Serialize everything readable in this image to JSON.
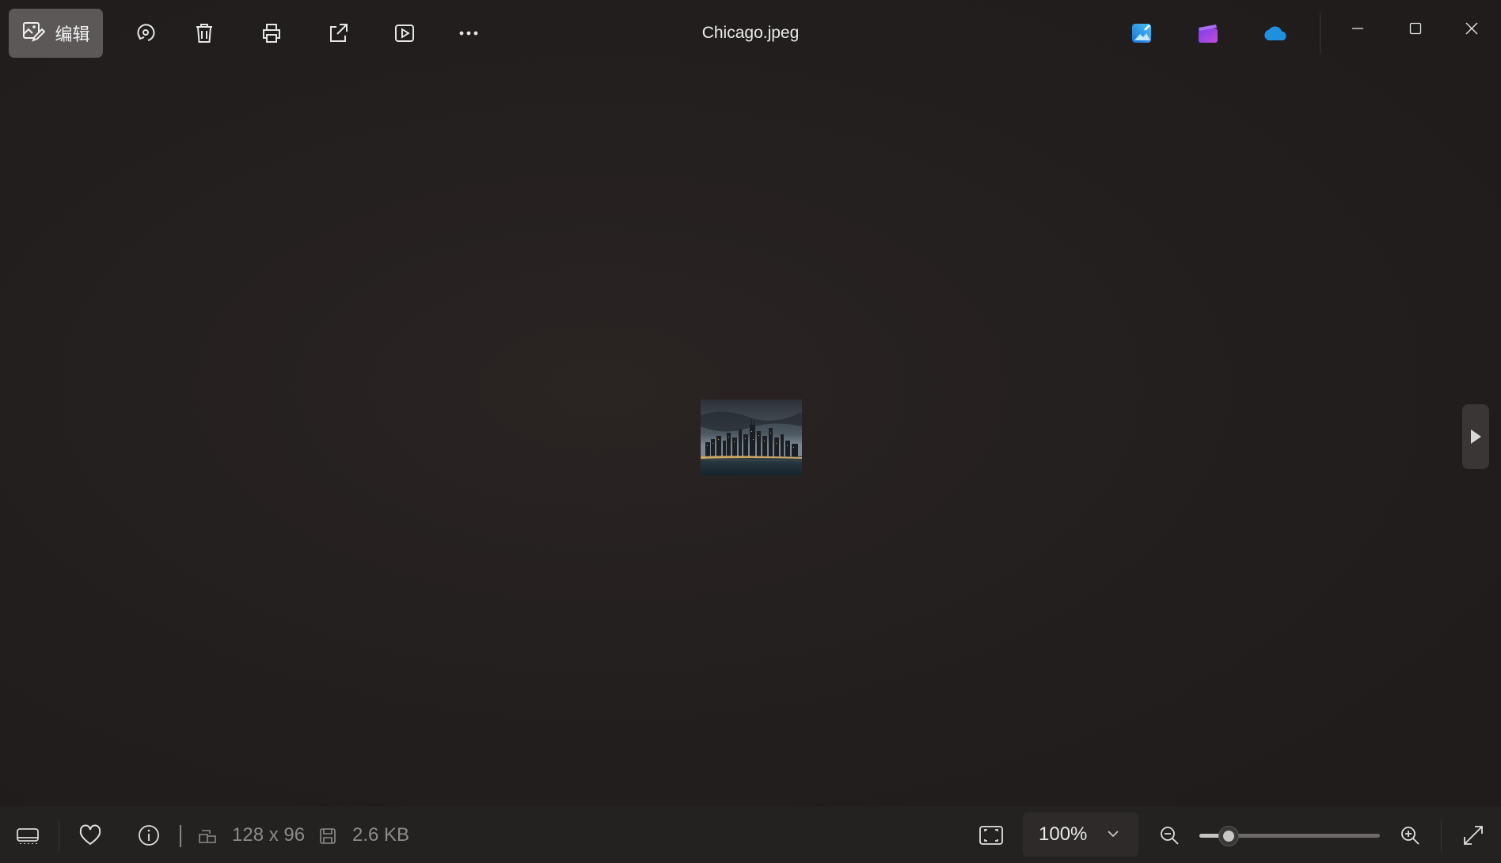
{
  "titlebar": {
    "edit_label": "编辑",
    "file_name": "Chicago.jpeg",
    "icons": [
      "edit-image-icon",
      "rotate-icon",
      "delete-icon",
      "print-icon",
      "share-icon",
      "slideshow-icon",
      "more-icon",
      "photo-editor-app-icon",
      "clipchamp-icon",
      "onedrive-icon",
      "minimize-icon",
      "maximize-icon",
      "close-icon"
    ]
  },
  "image": {
    "subject": "Chicago skyline at dusk"
  },
  "statusbar": {
    "dimensions": "128 x 96",
    "file_size": "2.6 KB",
    "zoom": "100%",
    "zoom_level": 0.16
  },
  "colors": {
    "background": "#221e1e",
    "bar": "#242121",
    "edit_button": "#5c5858",
    "onedrive": "#1f8fe0"
  }
}
